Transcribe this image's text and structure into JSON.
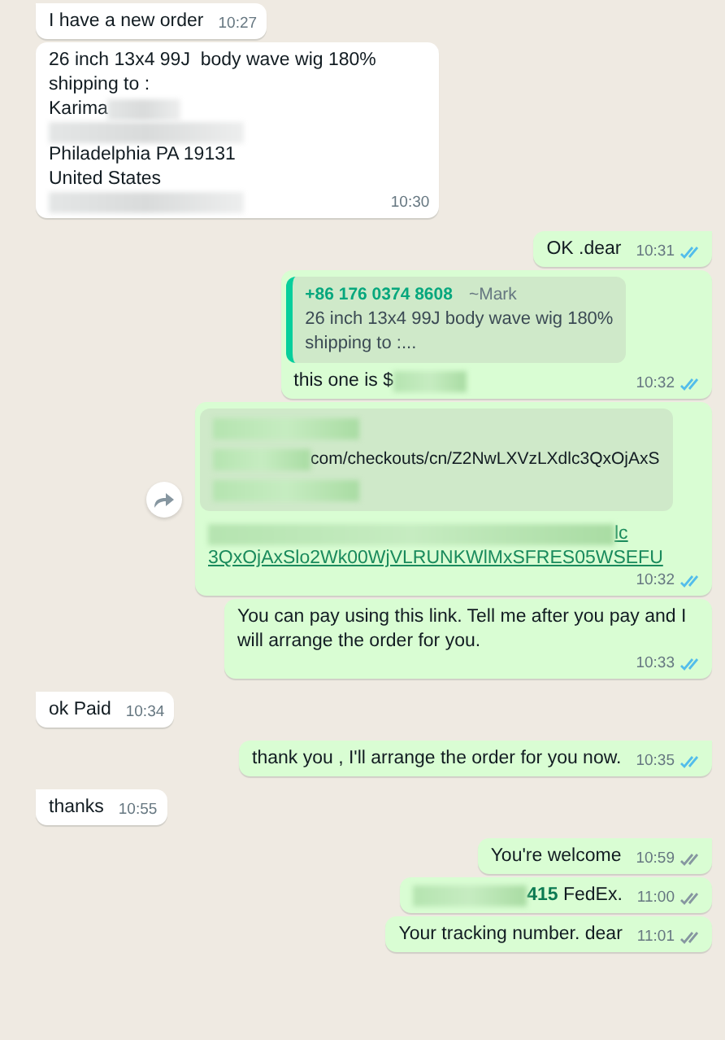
{
  "messages": [
    {
      "kind": "text",
      "outgoing": false,
      "tail": true,
      "lines": [
        [
          {
            "kind": "text",
            "text": "I have a new order"
          }
        ]
      ],
      "time": "10:27"
    },
    {
      "kind": "text",
      "outgoing": false,
      "tail": false,
      "lines": [
        [
          {
            "kind": "text",
            "text": "26 inch 13x4 99J  body wave wig 180%"
          }
        ],
        [
          {
            "kind": "text",
            "text": "shipping to :"
          }
        ],
        [
          {
            "kind": "text",
            "text": "Karima"
          },
          {
            "kind": "blur"
          }
        ],
        [
          {
            "kind": "blur"
          }
        ],
        [
          {
            "kind": "text",
            "text": "Philadelphia PA 19131"
          }
        ],
        [
          {
            "kind": "text",
            "text": "United States"
          }
        ],
        [
          {
            "kind": "blur"
          }
        ]
      ],
      "time": "10:30"
    },
    {
      "kind": "text",
      "outgoing": true,
      "tail": true,
      "read": true,
      "lines": [
        [
          {
            "kind": "text",
            "text": "OK .dear"
          }
        ]
      ],
      "time": "10:31"
    },
    {
      "kind": "quote",
      "outgoing": true,
      "tail": false,
      "read": true,
      "quote": {
        "sender": "+86 176 0374 8608",
        "name": "~Mark",
        "lines": [
          "26 inch 13x4 99J  body wave wig 180%",
          "shipping to :..."
        ]
      },
      "lines": [
        [
          {
            "kind": "text",
            "text": "this one is $"
          },
          {
            "kind": "blur"
          }
        ]
      ],
      "time": "10:32"
    },
    {
      "kind": "link",
      "outgoing": true,
      "tail": false,
      "read": true,
      "forward": true,
      "preview": [
        [
          {
            "kind": "blur"
          }
        ],
        [
          {
            "kind": "blur"
          },
          {
            "kind": "text",
            "text": "com/checkouts/cn/Z2NwLXVzLXdlc3QxOjAxS"
          }
        ],
        [
          {
            "kind": "blur"
          }
        ]
      ],
      "lines": [
        [
          {
            "kind": "blur"
          },
          {
            "kind": "link",
            "text": "lc"
          }
        ],
        [
          {
            "kind": "link",
            "text": "3QxOjAxSlo2Wk00WjVLRUNKWlMxSFRES05WSEFU"
          }
        ]
      ],
      "time": "10:32"
    },
    {
      "kind": "text",
      "outgoing": true,
      "tail": false,
      "read": true,
      "lines": [
        [
          {
            "kind": "text",
            "text": "You can pay using this link. Tell me after you pay and I will arrange the order for you."
          }
        ]
      ],
      "time": "10:33"
    },
    {
      "kind": "text",
      "outgoing": false,
      "tail": true,
      "lines": [
        [
          {
            "kind": "text",
            "text": "ok Paid"
          }
        ]
      ],
      "time": "10:34"
    },
    {
      "kind": "text",
      "outgoing": true,
      "tail": true,
      "read": true,
      "lines": [
        [
          {
            "kind": "text",
            "text": "thank you , I'll arrange the order for you now."
          }
        ]
      ],
      "time": "10:35"
    },
    {
      "kind": "text",
      "outgoing": false,
      "tail": true,
      "lines": [
        [
          {
            "kind": "text",
            "text": "thanks"
          }
        ]
      ],
      "time": "10:55"
    },
    {
      "kind": "text",
      "outgoing": true,
      "tail": true,
      "read": false,
      "lines": [
        [
          {
            "kind": "text",
            "text": "You're welcome"
          }
        ]
      ],
      "time": "10:59"
    },
    {
      "kind": "text",
      "outgoing": true,
      "tail": false,
      "read": false,
      "lines": [
        [
          {
            "kind": "blur"
          },
          {
            "kind": "bold",
            "text": "415"
          },
          {
            "kind": "text",
            "text": " FedEx."
          }
        ]
      ],
      "time": "11:00"
    },
    {
      "kind": "text",
      "outgoing": true,
      "tail": false,
      "read": false,
      "lines": [
        [
          {
            "kind": "text",
            "text": "Your tracking number. dear"
          }
        ]
      ],
      "time": "11:01"
    }
  ]
}
